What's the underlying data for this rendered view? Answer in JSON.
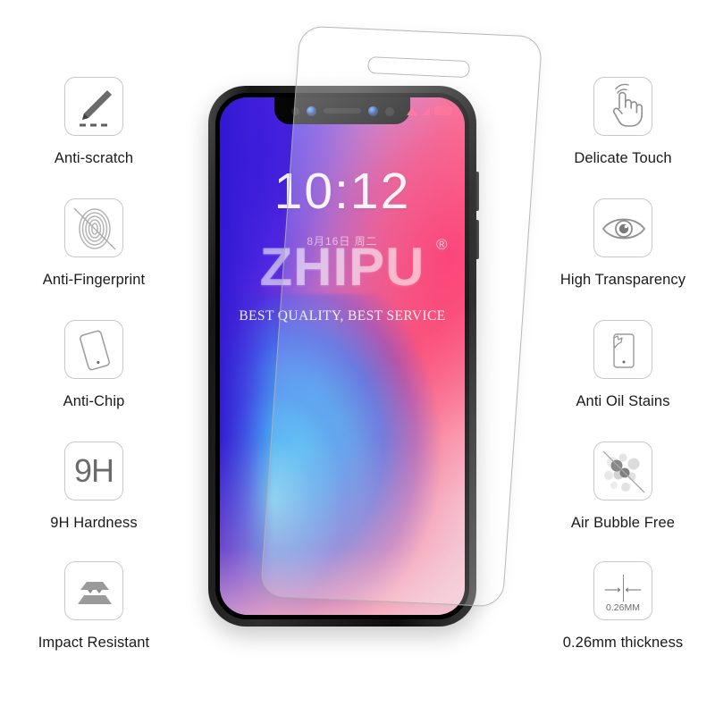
{
  "product": {
    "type": "tempered-glass-screen-protector",
    "brand": "ZHIPU",
    "registered_mark": "®",
    "tagline": "BEST QUALITY, BEST SERVICE"
  },
  "phone": {
    "lock_screen": {
      "time": "10:12",
      "date": "8月16日 周二"
    },
    "status_icons": [
      "wifi-icon",
      "signal-icon",
      "battery-icon"
    ],
    "notch_elements": [
      "proximity-sensor",
      "front-camera",
      "earpiece-speaker",
      "front-camera-secondary",
      "light-sensor"
    ],
    "side_buttons": [
      "volume-up-button",
      "volume-down-button"
    ]
  },
  "features_left": [
    {
      "id": "anti-scratch",
      "label": "Anti-scratch",
      "icon": "scratch-pen-icon"
    },
    {
      "id": "anti-fingerprint",
      "label": "Anti-Fingerprint",
      "icon": "fingerprint-icon"
    },
    {
      "id": "anti-chip",
      "label": "Anti-Chip",
      "icon": "phone-tilt-icon"
    },
    {
      "id": "hardness-9h",
      "label": "9H Hardness",
      "icon": "9h-text-icon",
      "icon_text": "9H"
    },
    {
      "id": "impact-resistant",
      "label": "Impact Resistant",
      "icon": "layers-impact-icon"
    }
  ],
  "features_right": [
    {
      "id": "delicate-touch",
      "label": "Delicate Touch",
      "icon": "touch-hand-icon"
    },
    {
      "id": "high-transparency",
      "label": "High Transparency",
      "icon": "eye-icon"
    },
    {
      "id": "anti-oil-stains",
      "label": "Anti Oil Stains",
      "icon": "oil-stain-phone-icon"
    },
    {
      "id": "air-bubble-free",
      "label": "Air Bubble Free",
      "icon": "bubbles-icon"
    },
    {
      "id": "thickness",
      "label": "0.26mm thickness",
      "icon": "thickness-gauge-icon",
      "icon_text": "0.26MM"
    }
  ],
  "colors": {
    "background": "#ffffff",
    "label_text": "#1a1a1a",
    "icon_outline": "#c9c9c9",
    "icon_fill": "#6b6b6b",
    "status_accent": "#ff4d7e",
    "wallpaper_blue": "#3a1fd8",
    "wallpaper_cyan": "#56d6f6",
    "wallpaper_pink": "#f7467e"
  }
}
